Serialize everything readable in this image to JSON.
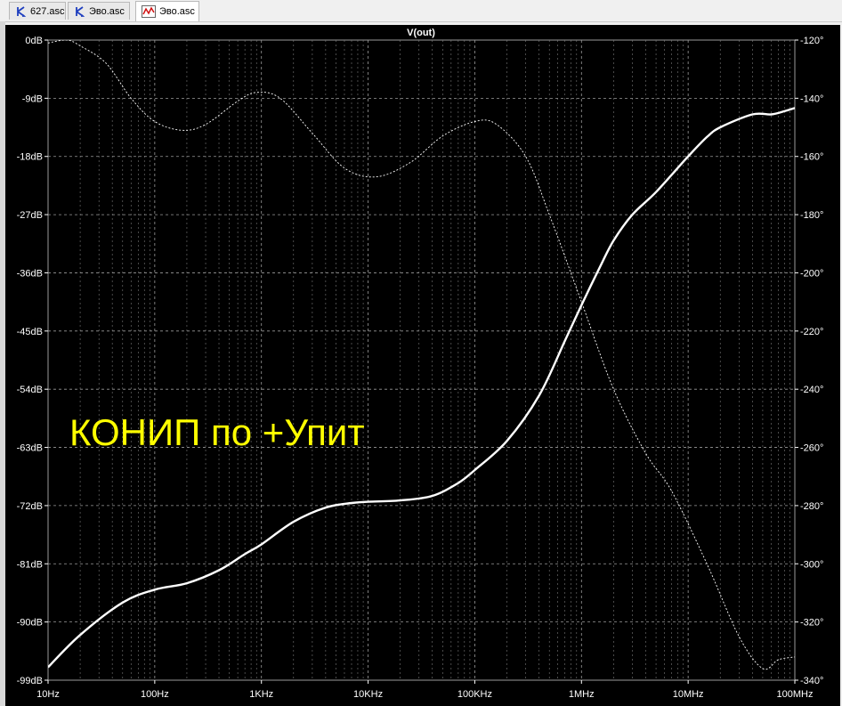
{
  "tabs": [
    {
      "label": "627.asc",
      "icon": "schematic-icon"
    },
    {
      "label": "Эво.asc",
      "icon": "schematic-icon"
    },
    {
      "label": "Эво.asc",
      "icon": "waveform-icon",
      "active": true
    }
  ],
  "chart_data": {
    "type": "line",
    "title": "V(out)",
    "annotation": "КОНИП по +Упит",
    "x_scale": "log",
    "xlim": [
      10,
      100000000
    ],
    "x_ticks": [
      {
        "value": 10,
        "label": "10Hz"
      },
      {
        "value": 100,
        "label": "100Hz"
      },
      {
        "value": 1000,
        "label": "1KHz"
      },
      {
        "value": 10000,
        "label": "10KHz"
      },
      {
        "value": 100000,
        "label": "100KHz"
      },
      {
        "value": 1000000,
        "label": "1MHz"
      },
      {
        "value": 10000000,
        "label": "10MHz"
      },
      {
        "value": 100000000,
        "label": "100MHz"
      }
    ],
    "y_left": {
      "lim": [
        -99,
        0
      ],
      "ticks": [
        {
          "value": 0,
          "label": "0dB"
        },
        {
          "value": -9,
          "label": "-9dB"
        },
        {
          "value": -18,
          "label": "-18dB"
        },
        {
          "value": -27,
          "label": "-27dB"
        },
        {
          "value": -36,
          "label": "-36dB"
        },
        {
          "value": -45,
          "label": "-45dB"
        },
        {
          "value": -54,
          "label": "-54dB"
        },
        {
          "value": -63,
          "label": "-63dB"
        },
        {
          "value": -72,
          "label": "-72dB"
        },
        {
          "value": -81,
          "label": "-81dB"
        },
        {
          "value": -90,
          "label": "-90dB"
        },
        {
          "value": -99,
          "label": "-99dB"
        }
      ]
    },
    "y_right": {
      "lim": [
        -340,
        -120
      ],
      "ticks": [
        {
          "value": -120,
          "label": "-120°"
        },
        {
          "value": -140,
          "label": "-140°"
        },
        {
          "value": -160,
          "label": "-160°"
        },
        {
          "value": -180,
          "label": "-180°"
        },
        {
          "value": -200,
          "label": "-200°"
        },
        {
          "value": -220,
          "label": "-220°"
        },
        {
          "value": -240,
          "label": "-240°"
        },
        {
          "value": -260,
          "label": "-260°"
        },
        {
          "value": -280,
          "label": "-280°"
        },
        {
          "value": -300,
          "label": "-300°"
        },
        {
          "value": -320,
          "label": "-320°"
        },
        {
          "value": -340,
          "label": "-340°"
        }
      ]
    },
    "grid": true,
    "series": [
      {
        "axis": "left",
        "style": "solid",
        "color": "#ffffff",
        "points": [
          [
            10,
            -97
          ],
          [
            20,
            -92
          ],
          [
            50,
            -87
          ],
          [
            100,
            -85
          ],
          [
            200,
            -84
          ],
          [
            400,
            -82
          ],
          [
            700,
            -79.5
          ],
          [
            1000,
            -78
          ],
          [
            2000,
            -74.5
          ],
          [
            4000,
            -72.3
          ],
          [
            7000,
            -71.6
          ],
          [
            10000,
            -71.4
          ],
          [
            20000,
            -71.2
          ],
          [
            40000,
            -70.5
          ],
          [
            70000,
            -68.5
          ],
          [
            100000,
            -66.5
          ],
          [
            200000,
            -62
          ],
          [
            400000,
            -55
          ],
          [
            700000,
            -46.5
          ],
          [
            1000000,
            -41
          ],
          [
            1500000,
            -35
          ],
          [
            2000000,
            -31
          ],
          [
            3000000,
            -27
          ],
          [
            5000000,
            -23.5
          ],
          [
            10000000,
            -18
          ],
          [
            15000000,
            -15
          ],
          [
            20000000,
            -13.5
          ],
          [
            40000000,
            -11.5
          ],
          [
            60000000,
            -11.5
          ],
          [
            80000000,
            -11
          ],
          [
            100000000,
            -10.5
          ]
        ]
      },
      {
        "axis": "right",
        "style": "dashed",
        "color": "#ffffff",
        "points": [
          [
            10,
            -121
          ],
          [
            15,
            -120
          ],
          [
            20,
            -122
          ],
          [
            35,
            -128
          ],
          [
            60,
            -140
          ],
          [
            100,
            -148
          ],
          [
            180,
            -151
          ],
          [
            300,
            -149
          ],
          [
            600,
            -141
          ],
          [
            900,
            -138
          ],
          [
            1500,
            -140
          ],
          [
            3000,
            -152
          ],
          [
            6000,
            -164
          ],
          [
            12000,
            -167
          ],
          [
            25000,
            -162
          ],
          [
            50000,
            -153
          ],
          [
            100000,
            -148
          ],
          [
            160000,
            -149
          ],
          [
            300000,
            -160
          ],
          [
            500000,
            -180
          ],
          [
            1000000,
            -210
          ],
          [
            2000000,
            -240
          ],
          [
            4000000,
            -262
          ],
          [
            7000000,
            -275
          ],
          [
            15000000,
            -300
          ],
          [
            30000000,
            -325
          ],
          [
            50000000,
            -336
          ],
          [
            70000000,
            -333
          ],
          [
            100000000,
            -332
          ]
        ]
      }
    ]
  }
}
